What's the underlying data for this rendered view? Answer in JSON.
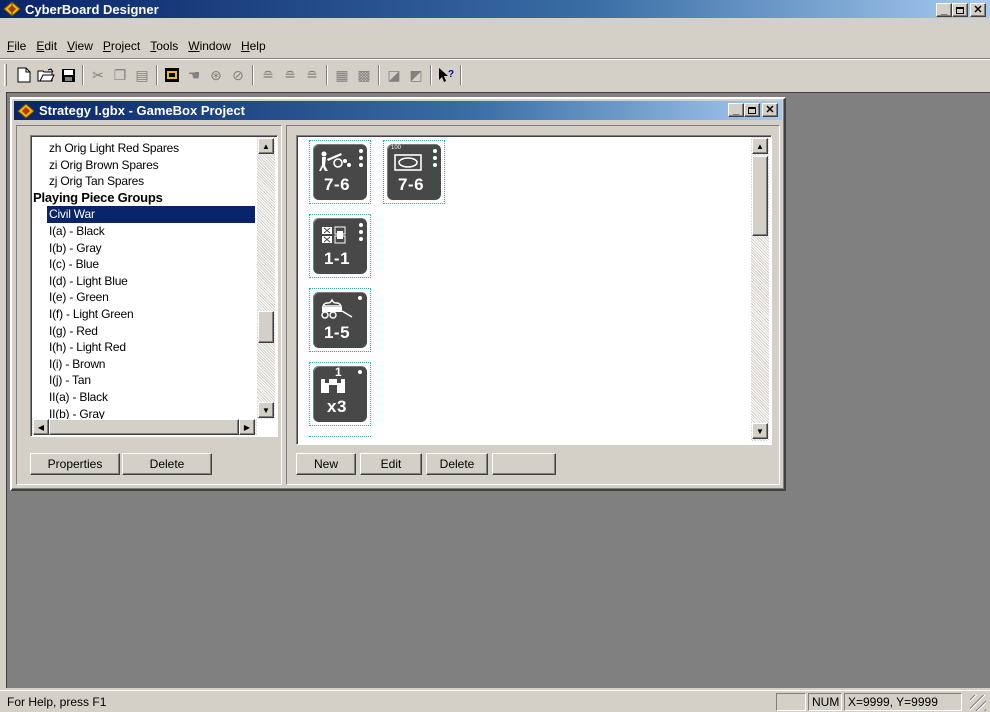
{
  "app": {
    "title": "CyberBoard Designer"
  },
  "menu": [
    {
      "label": "File",
      "u": "F",
      "rest": "ile"
    },
    {
      "label": "Edit",
      "u": "E",
      "rest": "dit"
    },
    {
      "label": "View",
      "u": "V",
      "rest": "iew"
    },
    {
      "label": "Project",
      "u": "P",
      "rest": "roject"
    },
    {
      "label": "Tools",
      "u": "T",
      "rest": "ools"
    },
    {
      "label": "Window",
      "u": "W",
      "rest": "indow"
    },
    {
      "label": "Help",
      "u": "H",
      "rest": "elp"
    }
  ],
  "toolbar": {
    "icons": [
      "new-file-icon",
      "open-folder-icon",
      "save-disk-icon",
      "cut-icon",
      "copy-icon",
      "paste-icon",
      "draw-mode-icon",
      "move-icon",
      "rotate-icon",
      "cancel-icon",
      "stack-icon",
      "stack-alt-icon",
      "stack-third-icon",
      "grid-icon",
      "grid-fine-icon",
      "bring-front-icon",
      "send-back-icon",
      "context-help-icon"
    ]
  },
  "child": {
    "title": "Strategy I.gbx - GameBox Project"
  },
  "tree": {
    "items": [
      {
        "label": "zh Orig Light Red Spares",
        "style": "child"
      },
      {
        "label": "zi Orig Brown Spares",
        "style": "child"
      },
      {
        "label": "zj Orig Tan Spares",
        "style": "child"
      },
      {
        "label": "Playing Piece Groups",
        "style": "header"
      },
      {
        "label": "Civil War",
        "style": "selected"
      },
      {
        "label": "I(a) - Black",
        "style": "child"
      },
      {
        "label": "I(b) - Gray",
        "style": "child"
      },
      {
        "label": "I(c) - Blue",
        "style": "child"
      },
      {
        "label": "I(d) - Light Blue",
        "style": "child"
      },
      {
        "label": "I(e) - Green",
        "style": "child"
      },
      {
        "label": "I(f) - Light Green",
        "style": "child"
      },
      {
        "label": "I(g) - Red",
        "style": "child"
      },
      {
        "label": "I(h) - Light Red",
        "style": "child"
      },
      {
        "label": "I(i) - Brown",
        "style": "child"
      },
      {
        "label": "I(j) - Tan",
        "style": "child"
      },
      {
        "label": "II(a) - Black",
        "style": "child"
      },
      {
        "label": "II(b) - Gray",
        "style": "child"
      }
    ]
  },
  "left_buttons": {
    "properties": "Properties",
    "delete": "Delete"
  },
  "right_buttons": {
    "new": "New",
    "edit": "Edit",
    "delete": "Delete",
    "blank": ""
  },
  "pieces": [
    {
      "value": "7-6",
      "symbol": "artillery-crew-icon"
    },
    {
      "value": "7-6",
      "symbol": "box-unit-icon",
      "tag": "100"
    },
    {
      "value": "1-1",
      "symbol": "engineer-grid-icon"
    },
    {
      "value": "1-5",
      "symbol": "wagon-supply-icon"
    },
    {
      "value": "x3",
      "symbol": "fortification-icon",
      "tag": "1"
    }
  ],
  "status": {
    "help": "For Help, press F1",
    "num": "NUM",
    "coords": "X=9999, Y=9999"
  }
}
